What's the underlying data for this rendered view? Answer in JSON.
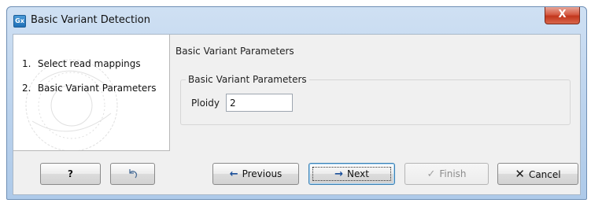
{
  "window": {
    "title": "Basic Variant Detection",
    "app_icon_text": "Gx",
    "close_symbol": "X"
  },
  "steps": [
    {
      "number": "1.",
      "label": "Select read mappings"
    },
    {
      "number": "2.",
      "label": "Basic Variant Parameters"
    }
  ],
  "main": {
    "section_header": "Basic Variant Parameters",
    "group_title": "Basic Variant Parameters",
    "ploidy_label": "Ploidy",
    "ploidy_value": "2"
  },
  "buttons": {
    "help": "?",
    "undo_icon": "reset-icon",
    "previous": "Previous",
    "previous_icon": "←",
    "next": "Next",
    "next_icon": "→",
    "finish": "Finish",
    "finish_icon": "✓",
    "cancel": "Cancel",
    "cancel_icon": "✕"
  },
  "colors": {
    "title_bar": "#b9d1ec",
    "close_button": "#c2361c",
    "dialog_background": "#f0f0f0"
  }
}
